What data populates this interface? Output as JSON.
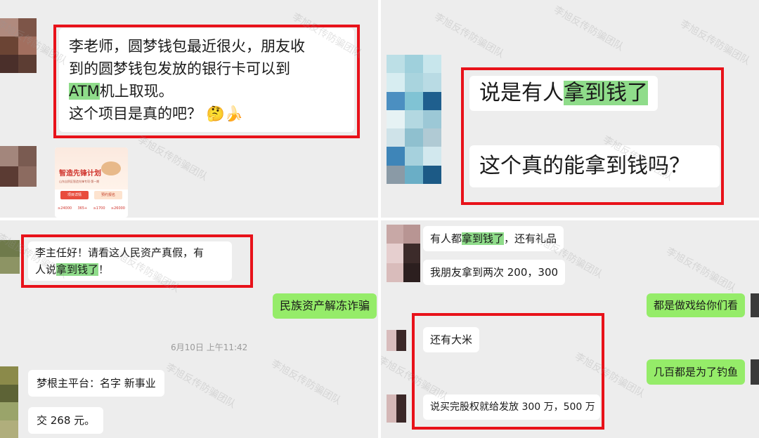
{
  "panel1": {
    "question_line1": "李老师，圆梦钱包最近很火，朋友收",
    "question_line2": "到的圆梦钱包发放的银行卡可以到",
    "question_line3_atm": "ATM",
    "question_line3_rest": "机上取现。",
    "question_line4": "这个项目是真的吧？",
    "question_emoji": "🤔🍌",
    "card": {
      "title": "智造先锋计划",
      "subtitle": "山东自贸区智造先锋专项·第一期",
      "btn1": "项目详情",
      "btn2": "预约报名",
      "stats": [
        "≥24000",
        "365+",
        "≥1700",
        "≥26000"
      ]
    }
  },
  "panel2": {
    "msg1_prefix": "说是有人",
    "msg1_highlight": "拿到钱了",
    "msg2": "这个真的能拿到钱吗？"
  },
  "panel3": {
    "msg1_line1": "李主任好！请看这人民资产真假，有",
    "msg1_line2_prefix": "人说",
    "msg1_line2_highlight": "拿到钱了",
    "msg1_line2_suffix": "！",
    "reply": "民族资产解冻诈骗",
    "timestamp": "6月10日 上午11:42",
    "msg2": "梦根主平台：名字 新事业",
    "msg3": "交 268 元。"
  },
  "panel4": {
    "msg1_prefix": "有人都",
    "msg1_highlight": "拿到钱了",
    "msg1_suffix": "，还有礼品",
    "msg2": "我朋友拿到两次 200，300",
    "reply1": "都是做戏给你们看",
    "msg3": "还有大米",
    "reply2": "几百都是为了钓鱼",
    "msg4": "说买完股权就给发放 300 万，500 万"
  },
  "watermark": "李旭反传防骗团队",
  "colors": {
    "chat_background": "#ededed",
    "bubble_incoming": "#ffffff",
    "bubble_outgoing": "#95ec69",
    "highlight": "#8fdc8a",
    "annotation_red": "#e8121a"
  }
}
